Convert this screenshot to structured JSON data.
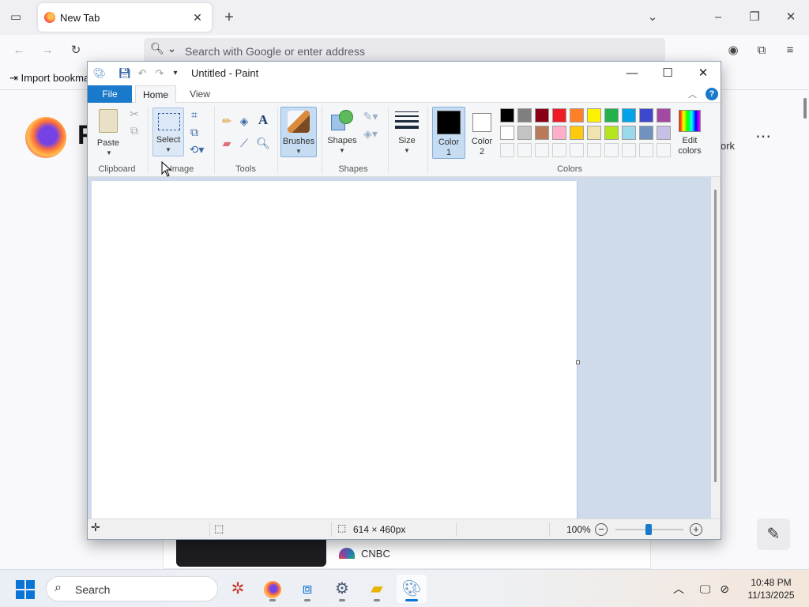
{
  "firefox": {
    "tab_title": "New Tab",
    "url_placeholder": "Search with Google or enter address",
    "bookmark_import": "Import bookma",
    "logo_word": "F",
    "shortcut_partial": "ork",
    "news_source": "CNBC"
  },
  "paint": {
    "window_title": "Untitled - Paint",
    "tabs": {
      "file": "File",
      "home": "Home",
      "view": "View"
    },
    "groups": {
      "clipboard": "Clipboard",
      "image": "Image",
      "tools": "Tools",
      "shapes": "Shapes",
      "colors": "Colors"
    },
    "buttons": {
      "paste": "Paste",
      "select": "Select",
      "brushes": "Brushes",
      "shapes": "Shapes",
      "size": "Size",
      "color1_a": "Color",
      "color1_b": "1",
      "color2_a": "Color",
      "color2_b": "2",
      "edit_colors_a": "Edit",
      "edit_colors_b": "colors"
    },
    "color1_value": "#000000",
    "color2_value": "#ffffff",
    "palette_row1": [
      "#000000",
      "#7f7f7f",
      "#880015",
      "#ed1c24",
      "#ff7f27",
      "#fff200",
      "#22b14c",
      "#00a2e8",
      "#3f48cc",
      "#a349a4"
    ],
    "palette_row2": [
      "#ffffff",
      "#c3c3c3",
      "#b97a57",
      "#ffaec9",
      "#ffc90e",
      "#efe4b0",
      "#b5e61d",
      "#99d9ea",
      "#7092be",
      "#c8bfe7"
    ],
    "status": {
      "canvas_size": "614 × 460px",
      "zoom": "100%"
    }
  },
  "taskbar": {
    "search_label": "Search",
    "time": "10:48 PM",
    "date": "11/13/2025"
  }
}
